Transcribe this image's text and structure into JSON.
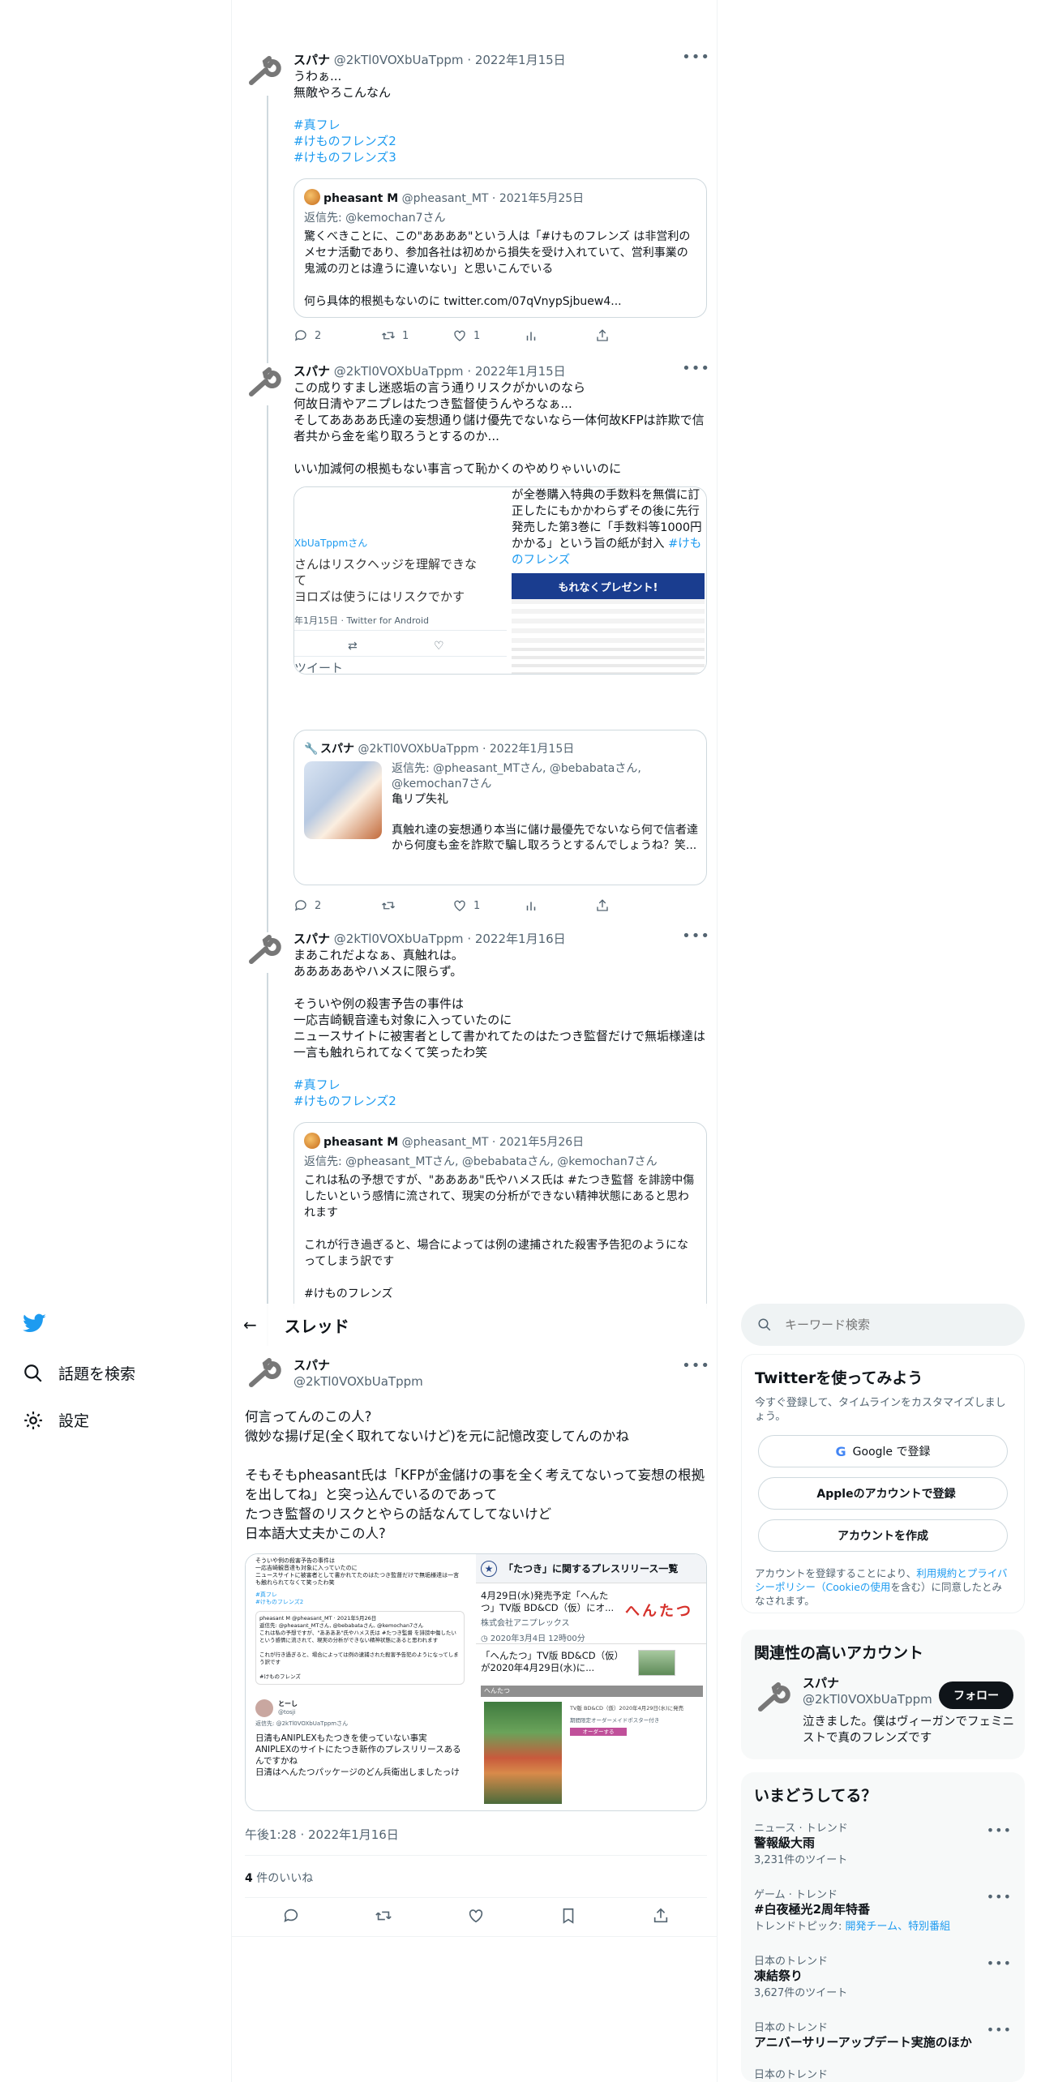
{
  "nav": {
    "explore_label": "話題を検索",
    "settings_label": "設定"
  },
  "tweets": [
    {
      "name": "スパナ",
      "handle": "@2kTl0VOXbUaTppm",
      "date": "· 2022年1月15日",
      "text": "うわぁ...\n無敵やろこんなん",
      "hashtags": [
        "#真フレ",
        "#けものフレンズ2",
        "#けものフレンズ3"
      ],
      "quote": {
        "name": "pheasant M",
        "handle": "@pheasant_MT",
        "date": "· 2021年5月25日",
        "reply_prefix": "返信先: ",
        "reply_to": "@kemochan7さん",
        "text": "驚くべきことに、この\"ああああ\"という人は「#けものフレンズ は非営利のメセナ活動であり、参加各社は初めから損失を受け入れていて、営利事業の鬼滅の刃とは違うに違いない」と思いこんでいる\n\n何ら具体的根拠もないのに twitter.com/07qVnypSjbuew4..."
      },
      "replies": "2",
      "retweets": "1",
      "likes": "1"
    },
    {
      "name": "スパナ",
      "handle": "@2kTl0VOXbUaTppm",
      "date": "· 2022年1月15日",
      "text": "この成りすまし迷惑垢の言う通りリスクがかいのなら\n何故日清やアニプレはたつき監督使うんやろなぁ...\nそしてああああ氏達の妄想通り儲け優先でないなら一体何故KFPは詐欺で信者共から金を毟り取ろうとするのか...\n\nいい加減何の根拠もない事言って恥かくのやめりゃいいのに",
      "media_left": {
        "handle": "XbUaTppmさん",
        "line1": "さんはリスクヘッジを理解できな",
        "line2": "て",
        "line3": "ヨロズは使うにはリスクでかす",
        "meta": "年1月15日 · Twitter for Android",
        "retweet": "ツイート"
      },
      "media_right": {
        "text": "が全巻購入特典の手数料を無償に訂正したにもかかわらずその後に先行発売した第3巻に「手数料等1000円かかる」という旨の紙が封入",
        "tag": "#けものフレンズ",
        "banner": "もれなくプレゼント!"
      },
      "quote": {
        "name": "スパナ",
        "handle": "@2kTl0VOXbUaTppm",
        "date": "· 2022年1月15日",
        "reply": "返信先: @pheasant_MTさん, @bebabataさん, @kemochan7さん",
        "text": "亀リプ失礼\n\n真触れ達の妄想通り本当に儲け最優先でないなら何で信者達から何度も金を詐欺で騙し取ろうとするんでしょうね？笑..."
      },
      "replies": "2",
      "retweets": "",
      "likes": "1"
    },
    {
      "name": "スパナ",
      "handle": "@2kTl0VOXbUaTppm",
      "date": "· 2022年1月16日",
      "text": "まあこれだよなぁ、真触れは。\nあああああやハメスに限らず。\n\nそういや例の殺害予告の事件は\n一応吉崎観音達も対象に入っていたのに\nニュースサイトに被害者として書かれてたのはたつき監督だけで無垢様達は一言も触れられてなくて笑ったわ笑",
      "hashtags": [
        "#真フレ",
        "#けものフレンズ2"
      ],
      "quote": {
        "name": "pheasant M",
        "handle": "@pheasant_MT",
        "date": "· 2021年5月26日",
        "reply_prefix": "返信先: ",
        "reply_to": "@pheasant_MTさん, @bebabataさん, @kemochan7さん",
        "text": "これは私の予想ですが、\"ああああ\"氏やハメス氏は #たつき監督 を誹謗中傷したいという感情に流されて、現実の分析ができない精神状態にあると思われます\n\nこれが行き過ぎると、場合によっては例の逮捕された殺害予告犯のようになってしまう訳です\n\n#けものフレンズ"
      }
    }
  ],
  "header": {
    "title": "スレッド"
  },
  "main_tweet": {
    "name": "スパナ",
    "handle": "@2kTl0VOXbUaTppm",
    "text": "何言ってんのこの人?\n微妙な揚げ足(全く取れてないけど)を元に記憶改変してんのかね\n\nそもそもpheasant氏は「KFPが金儲けの事を全く考えてないって妄想の根拠を出してね」と突っ込んでいるのであって\nたつき監督のリスクとやらの話なんてしてないけど\n日本語大丈夫かこの人?",
    "media_left": {
      "mini_text": "そういや例の殺害予告の事件は\n一応吉崎観音達も対象に入っていたのに\nニュースサイトに被害者として書かれてたのはたつき監督だけで無垢様達は一言も触れられてなくて笑ったわ笑",
      "mini_tags": "#真フレ\n#けものフレンズ2",
      "mini_quote": "pheasant M @pheasant_MT · 2021年5月26日\n返信先: @pheasant_MTさん, @bebabataさん, @kemochan7さん\nこれは私の予想ですが、\"ああああ\"氏やハメス氏は #たつき監督 を誹謗中傷したいという感情に流されて、現実の分析ができない精神状態にあると思われます\n\nこれが行き過ぎると、場合によっては例の逮捕された殺害予告犯のようになってしまう訳です\n\n#けものフレンズ",
      "user_name": "とーし",
      "user_handle": "@tosji",
      "user_reply": "返信先: @2kTl0VOXbUaTppmさん",
      "user_text": "日清もANIPLEXもたつきを使っていない事実\nANIPLEXのサイトにたつき新作のプレスリリースあるんですかね\n日清はへんたつパッケージのどん兵衛出しましたっけ"
    },
    "media_right": {
      "header": "「たつき」に関するプレスリリース一覧",
      "item1_title": "4月29日(水)発売予定「へんたつ」TV版 BD&CD（仮）にオ...",
      "item1_org": "株式会社アニプレックス",
      "item1_date": "2020年3月4日 12時00分",
      "item1_logo": "へんたつ",
      "item2_title": "「へんたつ」TV版 BD&CD（仮）が2020年4月29日(水)に...",
      "strip_label": "へんたつ",
      "side_text": "TV版 BD&CD（仮）2020年4月29日(水)に発売",
      "side_sub": "期間限定オーダーメイドポスター付き",
      "side_button": "オーダーする"
    },
    "timestamp": "午後1:28 · 2022年1月16日",
    "likes_count": "4",
    "likes_label": " 件のいいね"
  },
  "search": {
    "placeholder": "キーワード検索"
  },
  "signup": {
    "title": "Twitterを使ってみよう",
    "subtitle": "今すぐ登録して、タイムラインをカスタマイズしましょう。",
    "google_label": "Google で登録",
    "apple_label": "Appleのアカウントで登録",
    "create_label": "アカウントを作成",
    "terms_prefix": "アカウントを登録することにより、",
    "terms_link": "利用規約とプライバシーポリシー（Cookieの使用",
    "terms_suffix": "を含む）に同意したとみなされます。"
  },
  "related": {
    "title": "関連性の高いアカウント",
    "name": "スパナ",
    "handle": "@2kTl0VOXbUaTppm",
    "follow_label": "フォロー",
    "bio": "泣きました。僕はヴィーガンでフェミニストで真のフレンズです"
  },
  "trends": {
    "title": "いまどうしてる？",
    "items": [
      {
        "category": "ニュース · トレンド",
        "name": "警報級大雨",
        "count": "3,231件のツイート"
      },
      {
        "category": "ゲーム · トレンド",
        "name": "#白夜極光2周年特番",
        "topic_prefix": "トレンドトピック: ",
        "topic": "開発チーム、特別番組"
      },
      {
        "category": "日本のトレンド",
        "name": "凍結祭り",
        "count": "3,627件のツイート"
      },
      {
        "category": "日本のトレンド",
        "name": "アニバーサリーアップデート実施のほか"
      },
      {
        "category": "日本のトレンド"
      }
    ]
  },
  "colors": {
    "accent": "#1d9bf0",
    "text": "#0f1419",
    "muted": "#536471",
    "border": "#cfd9de",
    "panel_bg": "#f7f9f9"
  }
}
